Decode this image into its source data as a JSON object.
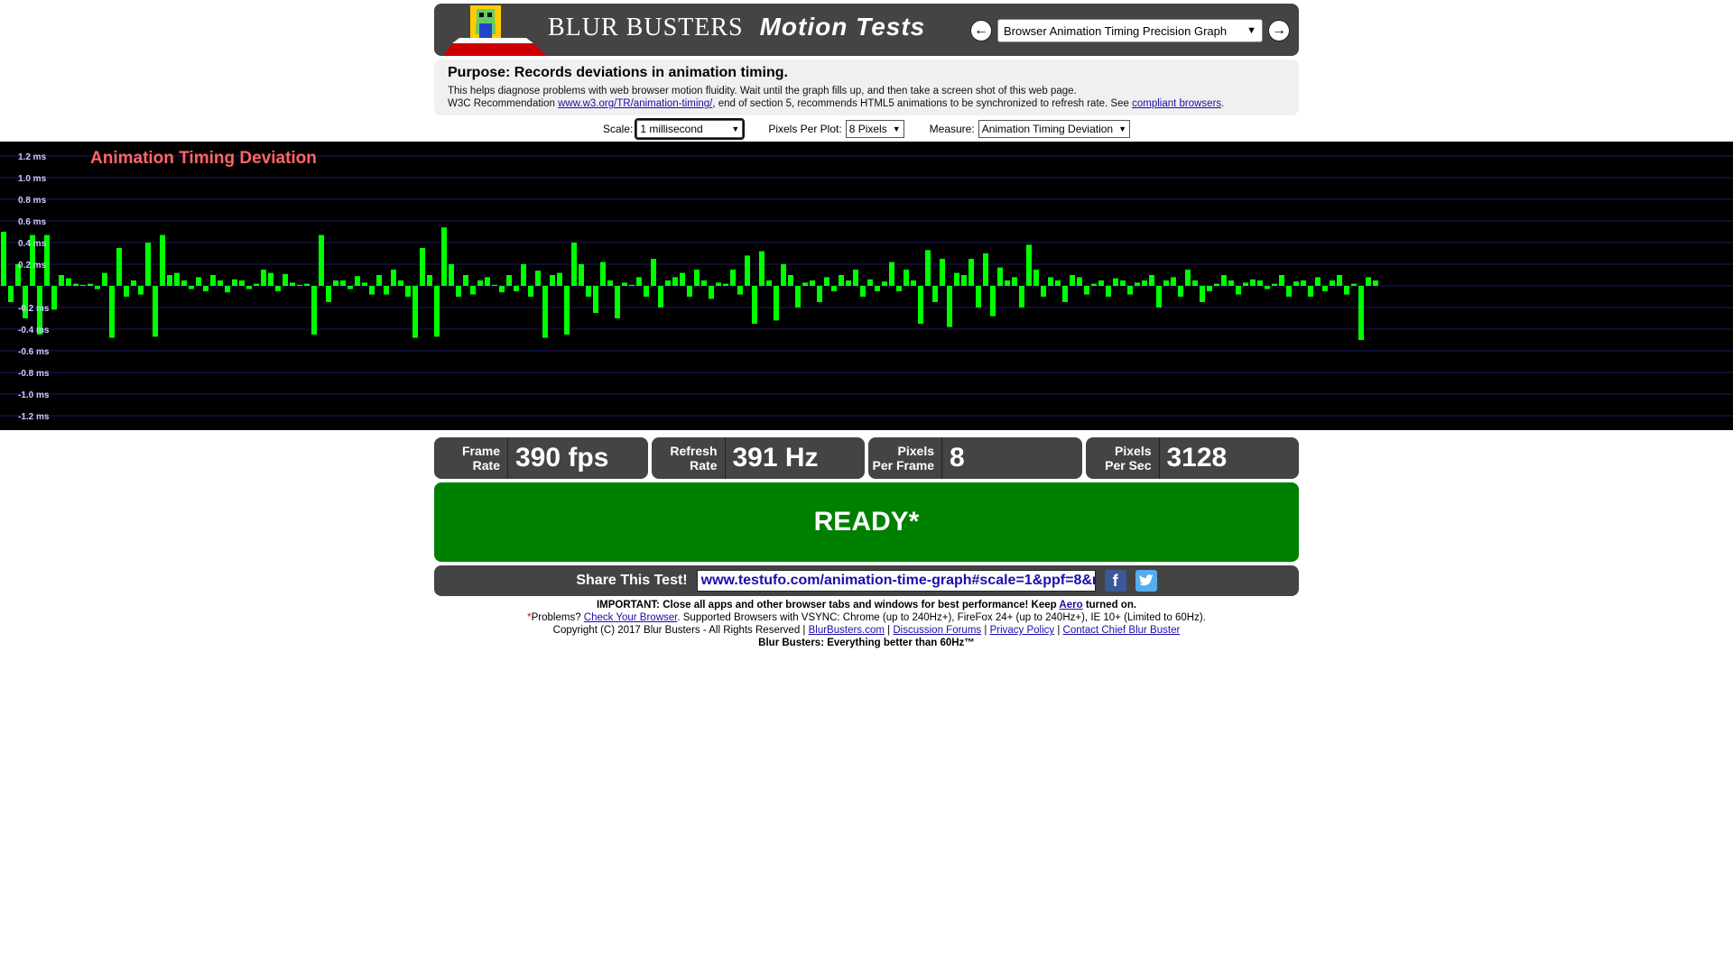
{
  "header": {
    "brand": "BLUR BUSTERS",
    "brand_sub": "Motion Tests",
    "selected_test": "Browser Animation Timing Precision Graph"
  },
  "purpose": {
    "title": "Purpose: Records deviations in animation timing.",
    "line1": "This helps diagnose problems with web browser motion fluidity. Wait until the graph fills up, and then take a screen shot of this web page.",
    "line2_prefix": "W3C Recommendation",
    "line2_link": "www.w3.org/TR/animation-timing/",
    "line2_mid": ", end of section 5, recommends HTML5 animations to be synchronized to refresh rate. See",
    "line2_link2": "compliant browsers",
    "line2_end": "."
  },
  "controls": {
    "scale_label": "Scale:",
    "scale_value": "1 millisecond",
    "ppp_label": "Pixels Per Plot:",
    "ppp_value": "8 Pixels",
    "measure_label": "Measure:",
    "measure_value": "Animation Timing Deviation"
  },
  "chart_data": {
    "type": "bar",
    "title": "Animation Timing Deviation",
    "ylim": [
      -1.3,
      1.3
    ],
    "ytick_labels": [
      "1.2 ms",
      "1.0 ms",
      "0.8 ms",
      "0.6 ms",
      "0.4 ms",
      "0.2 ms",
      "-0.2 ms",
      "-0.4 ms",
      "-0.6 ms",
      "-0.8 ms",
      "-1.0 ms",
      "-1.2 ms"
    ],
    "ytick_values": [
      1.2,
      1.0,
      0.8,
      0.6,
      0.4,
      0.2,
      -0.2,
      -0.4,
      -0.6,
      -0.8,
      -1.0,
      -1.2
    ],
    "values": [
      0.5,
      -0.15,
      0.2,
      -0.3,
      0.47,
      -0.45,
      0.47,
      -0.22,
      0.1,
      0.07,
      0.02,
      0.01,
      0.02,
      -0.03,
      0.12,
      -0.48,
      0.35,
      -0.1,
      0.05,
      -0.08,
      0.4,
      -0.47,
      0.47,
      0.1,
      0.12,
      0.05,
      -0.03,
      0.08,
      -0.05,
      0.1,
      0.05,
      -0.06,
      0.06,
      0.05,
      -0.03,
      0.02,
      0.15,
      0.12,
      -0.05,
      0.11,
      0.03,
      0.01,
      0.02,
      -0.45,
      0.47,
      -0.15,
      0.05,
      0.05,
      -0.03,
      0.09,
      0.03,
      -0.08,
      0.1,
      -0.08,
      0.15,
      0.05,
      -0.1,
      -0.48,
      0.35,
      0.1,
      -0.47,
      0.54,
      0.2,
      -0.1,
      0.1,
      -0.08,
      0.05,
      0.08,
      0.01,
      -0.06,
      0.1,
      -0.05,
      0.2,
      -0.1,
      0.14,
      -0.48,
      0.1,
      0.12,
      -0.45,
      0.4,
      0.2,
      -0.1,
      -0.25,
      0.22,
      0.05,
      -0.3,
      0.03,
      0.01,
      0.08,
      -0.1,
      0.25,
      -0.2,
      0.05,
      0.08,
      0.12,
      -0.1,
      0.15,
      0.05,
      -0.12,
      0.03,
      0.02,
      0.15,
      -0.08,
      0.28,
      -0.35,
      0.32,
      0.05,
      -0.32,
      0.2,
      0.1,
      -0.2,
      0.03,
      0.05,
      -0.15,
      0.08,
      -0.05,
      0.1,
      0.05,
      0.15,
      -0.1,
      0.06,
      -0.05,
      0.04,
      0.22,
      -0.05,
      0.15,
      0.05,
      -0.35,
      0.33,
      -0.15,
      0.25,
      -0.38,
      0.12,
      0.1,
      0.25,
      -0.2,
      0.3,
      -0.28,
      0.17,
      0.05,
      0.08,
      -0.2,
      0.38,
      0.15,
      -0.1,
      0.08,
      0.05,
      -0.15,
      0.1,
      0.08,
      -0.08,
      0.02,
      0.05,
      -0.1,
      0.07,
      0.05,
      -0.08,
      0.03,
      0.05,
      0.1,
      -0.2,
      0.05,
      0.08,
      -0.1,
      0.15,
      0.05,
      -0.15,
      -0.05,
      0.02,
      0.1,
      0.05,
      -0.08,
      0.03,
      0.06,
      0.05,
      -0.03,
      0.02,
      0.1,
      -0.1,
      0.04,
      0.05,
      -0.1,
      0.08,
      -0.05,
      0.05,
      0.1,
      -0.08,
      0.02,
      -0.5,
      0.08,
      0.05
    ],
    "bar_color": "#00ff00",
    "label_color": "#ff6666"
  },
  "stats": [
    {
      "label1": "Frame",
      "label2": "Rate",
      "value": "390 fps"
    },
    {
      "label1": "Refresh",
      "label2": "Rate",
      "value": "391 Hz"
    },
    {
      "label1": "Pixels",
      "label2": "Per Frame",
      "value": "8"
    },
    {
      "label1": "Pixels",
      "label2": "Per Sec",
      "value": "3128"
    }
  ],
  "ready_label": "READY*",
  "share": {
    "label": "Share This Test!",
    "url": "www.testufo.com/animation-time-graph#scale=1&ppf=8&r"
  },
  "footer": {
    "important_prefix": "IMPORTANT: Close all apps and other browser tabs and windows for best performance! Keep",
    "important_link": "Aero",
    "important_suffix": "turned on.",
    "problems_star": "*",
    "problems_prefix": "Problems?",
    "problems_link": "Check Your Browser",
    "problems_rest": ". Supported Browsers with VSYNC: Chrome (up to 240Hz+), FireFox 24+ (up to 240Hz+), IE 10+ (Limited to 60Hz).",
    "copyright": "Copyright (C) 2017 Blur Busters - All Rights Reserved |",
    "link_bb": "BlurBusters.com",
    "link_forums": "Discussion Forums",
    "link_privacy": "Privacy Policy",
    "link_contact": "Contact Chief Blur Buster",
    "sep": "|",
    "tagline": "Blur Busters: Everything better than 60Hz™"
  }
}
